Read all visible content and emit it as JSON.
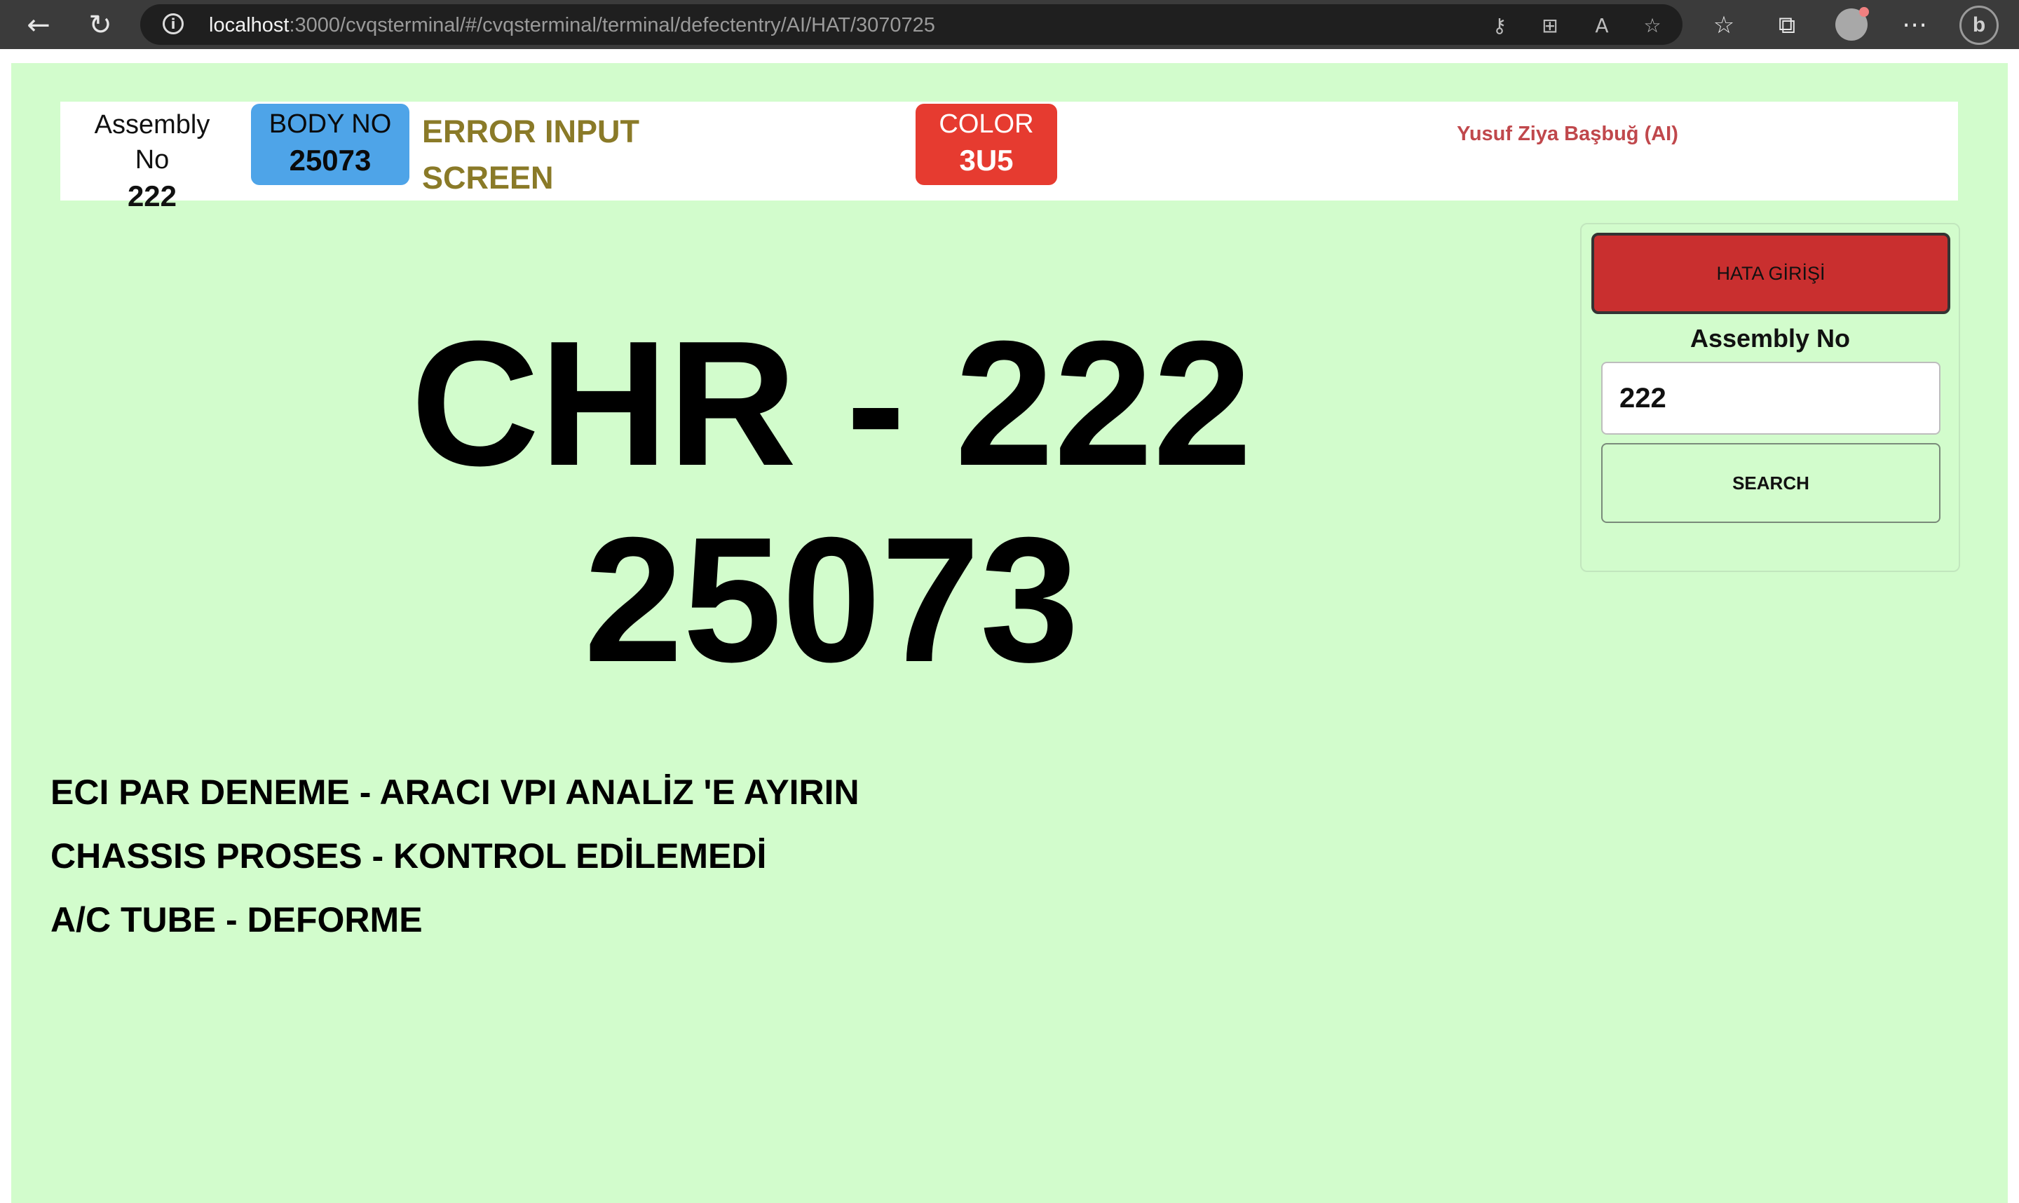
{
  "browser": {
    "url_host": "localhost",
    "url_path": ":3000/cvqsterminal/#/cvqsterminal/terminal/defectentry/AI/HAT/3070725",
    "icons": [
      "back-arrow-icon",
      "reload-icon",
      "info-icon",
      "key-icon",
      "apps-icon",
      "read-aloud-icon",
      "add-favorite-icon",
      "favorites-icon",
      "collections-icon",
      "profile-avatar",
      "more-icon",
      "bing-icon"
    ]
  },
  "header": {
    "assembly_label": "Assembly No",
    "assembly_value": "222",
    "body_label": "BODY NO",
    "body_value": "25073",
    "title_line1": "ERROR INPUT",
    "title_line2": "SCREEN",
    "color_label": "COLOR",
    "color_value": "3U5",
    "user": "Yusuf Ziya Başbuğ (AI)"
  },
  "main": {
    "model_line": "CHR - 222",
    "body_line": "25073"
  },
  "defects": [
    "ECI PAR DENEME - ARACI VPI ANALİZ 'E AYIRIN",
    "CHASSIS PROSES - KONTROL EDİLEMEDİ",
    "A/C TUBE - DEFORME"
  ],
  "side_panel": {
    "hata_button": "HATA GİRİŞİ",
    "assembly_label": "Assembly No",
    "assembly_input": "222",
    "search_button": "SEARCH"
  },
  "colors": {
    "page_background": "#d2fccc",
    "body_badge": "#4ea4e8",
    "color_badge": "#e63b30",
    "title": "#8a7a28",
    "user": "#c0484c",
    "hata_button": "#c92f2f"
  }
}
